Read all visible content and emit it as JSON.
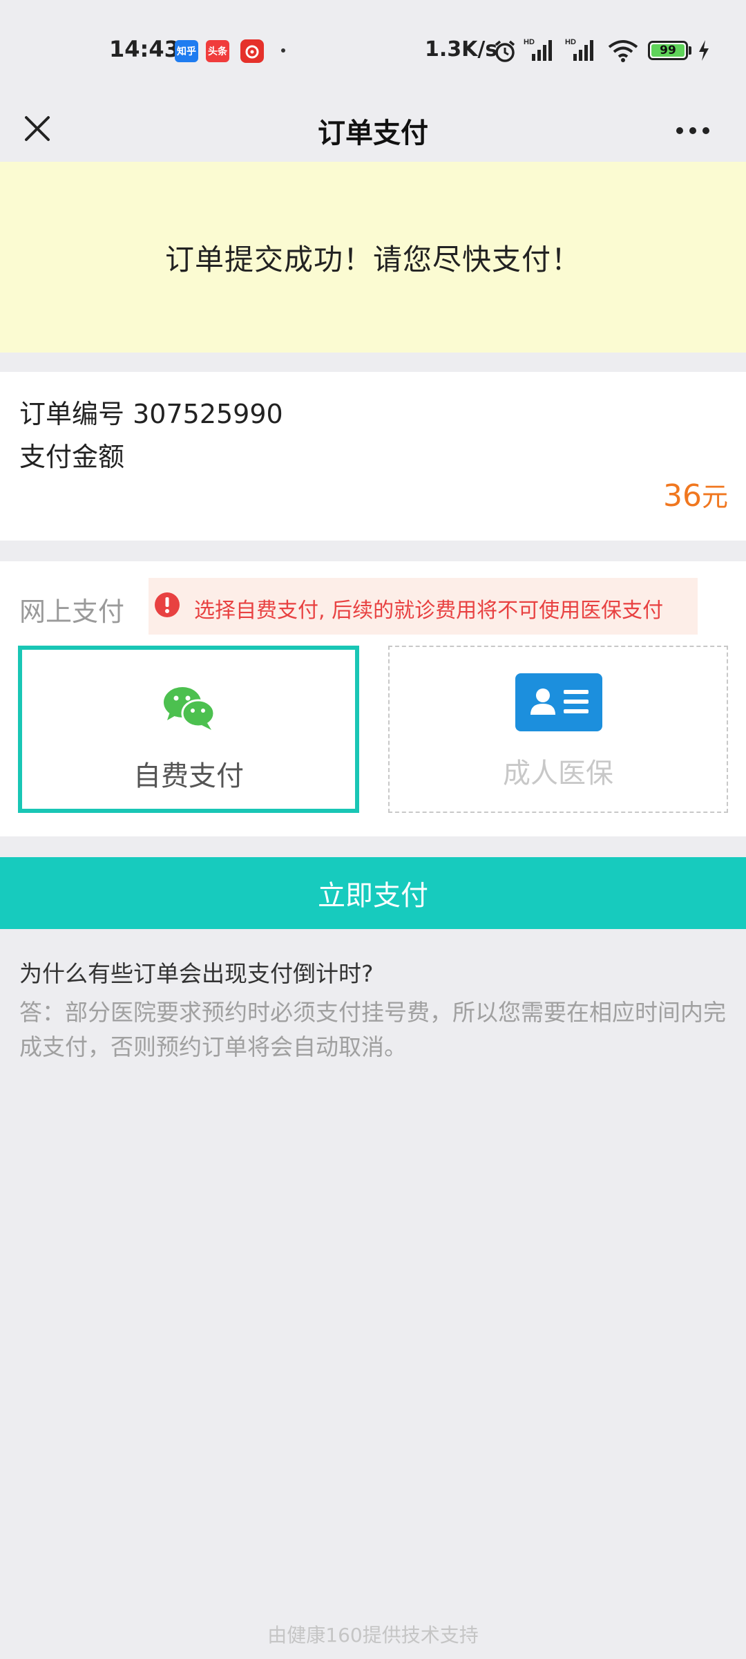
{
  "status_bar": {
    "time": "14:43",
    "apps": [
      "知乎",
      "头条",
      "网易云"
    ],
    "net_speed": "1.3K/s",
    "signal_labels": [
      "HD",
      "HD"
    ],
    "battery": "99"
  },
  "nav": {
    "title": "订单支付",
    "close_icon": "close-icon",
    "more_icon": "more-icon"
  },
  "banner": {
    "message": "订单提交成功！请您尽快支付！"
  },
  "order": {
    "number_label": "订单编号",
    "number": "307525990",
    "amount_label": "支付金额",
    "amount": "36",
    "amount_unit": "元"
  },
  "payment": {
    "label": "网上支付",
    "warning": "选择自费支付, 后续的就诊费用将不可使用医保支付",
    "options": [
      {
        "label": "自费支付",
        "icon": "wechat-icon",
        "selected": true
      },
      {
        "label": "成人医保",
        "icon": "id-card-icon",
        "selected": false
      }
    ],
    "pay_button": "立即支付"
  },
  "faq": {
    "question": "为什么有些订单会出现支付倒计时?",
    "answer": "答：部分医院要求预约时必须支付挂号费，所以您需要在相应时间内完成支付，否则预约订单将会自动取消。"
  },
  "footer": "由健康160提供技术支持",
  "colors": {
    "accent": "#17CBBE",
    "banner": "#FBFBD2",
    "amount": "#F0771F",
    "warning": "#E84141",
    "wechat": "#4CC04F",
    "id_card": "#1C8FDD"
  }
}
